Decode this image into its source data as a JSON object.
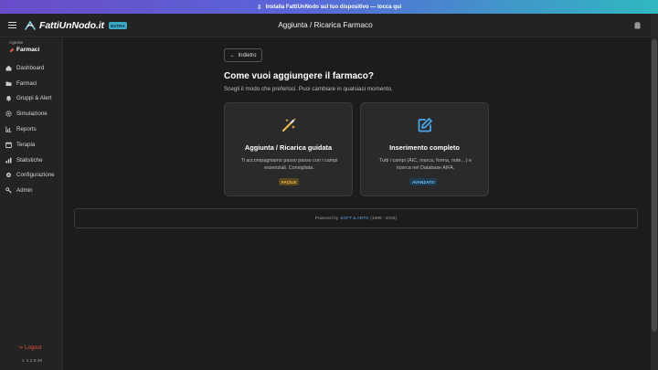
{
  "banner": {
    "text": "Installa FattiUnNodo sul tuo dispositivo — tocca qui",
    "icon": "download-icon"
  },
  "header": {
    "logo_text": "FattiUnNodo.it",
    "logo_tag": "EXTRA",
    "title": "Aggiunta / Ricarica Farmaco"
  },
  "sidebar": {
    "agent_label": "Agente",
    "agent_name": "Farmaci",
    "items": [
      {
        "label": "Dashboard",
        "icon": "home-icon"
      },
      {
        "label": "Farmaci",
        "icon": "folder-icon"
      },
      {
        "label": "Gruppi & Alert",
        "icon": "bell-icon"
      },
      {
        "label": "Simulazione",
        "icon": "gear-icon"
      },
      {
        "label": "Reports",
        "icon": "chart-icon"
      },
      {
        "label": "Terapia",
        "icon": "calendar-icon"
      },
      {
        "label": "Statistiche",
        "icon": "stats-icon"
      },
      {
        "label": "Configurazione",
        "icon": "cog-icon"
      },
      {
        "label": "Admin",
        "icon": "key-icon"
      }
    ],
    "logout": "Logout",
    "version": "v. 2.2.8.49"
  },
  "main": {
    "back": "Indietro",
    "title": "Come vuoi aggiungere il farmaco?",
    "subtitle": "Scegli il modo che preferisci. Puoi cambiare in qualsiasi momento.",
    "cards": [
      {
        "title": "Aggiunta / Ricarica guidata",
        "desc": "Ti accompagniamo passo passo con i campi essenziali. Consigliata.",
        "badge": "FACILE",
        "icon": "magic-wand-icon",
        "accent": "#f4c04a"
      },
      {
        "title": "Inserimento completo",
        "desc": "Tutti i campi (AIC, marca, forma, note…) e ricerca nel Database AIFA.",
        "badge": "AVANZATO",
        "icon": "edit-icon",
        "accent": "#4aa6e8"
      }
    ]
  },
  "footer": {
    "prefix": "Powered by",
    "link": "SOFT & ARTS",
    "suffix": "(1999 - 2026)"
  }
}
